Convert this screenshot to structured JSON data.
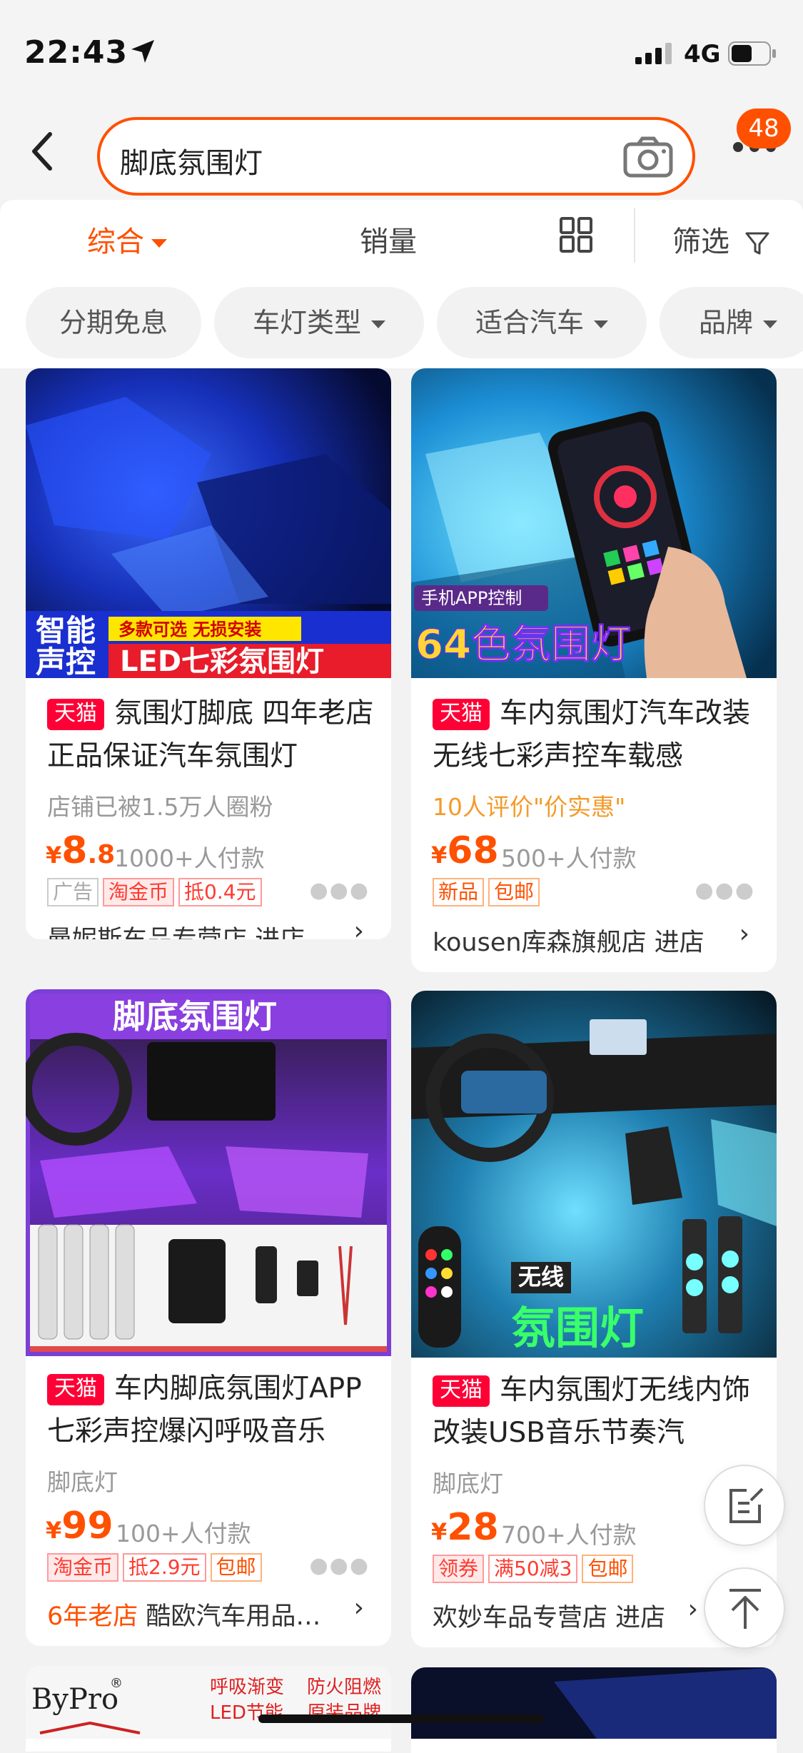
{
  "status_bar": {
    "time": "22:43",
    "network": "4G"
  },
  "header": {
    "search_query": "脚底氛围灯",
    "cart_badge": "48"
  },
  "sort_tabs": {
    "comprehensive": "综合",
    "sales": "销量",
    "filter": "筛选"
  },
  "filter_chips": [
    "分期免息",
    "车灯类型",
    "适合汽车",
    "品牌"
  ],
  "products": [
    {
      "image_text_1": "智能",
      "image_text_2": "声控",
      "image_banner": "多款可选 无损安装",
      "image_headline": "LED七彩氛围灯",
      "tmall": "天猫",
      "title": "氛围灯脚底 四年老店 正品保证汽车氛围灯",
      "subtitle": "店铺已被1.5万人圈粉",
      "price_symbol": "¥",
      "price_int": "8",
      "price_dec": ".8",
      "sold": "1000+人付款",
      "tags": [
        "广告",
        "淘金币",
        "抵0.4元"
      ],
      "store": "曼妮斯车品专营店",
      "enter": "进店"
    },
    {
      "image_badge": "手机APP控制",
      "image_headline": "64色氛围灯",
      "tmall": "天猫",
      "title": "车内氛围灯汽车改装无线七彩声控车载感",
      "subtitle": "10人评价\"价实惠\"",
      "price_symbol": "¥",
      "price_int": "68",
      "price_dec": "",
      "sold": "500+人付款",
      "tags": [
        "新品",
        "包邮"
      ],
      "store": "kousen库森旗舰店",
      "enter": "进店"
    },
    {
      "image_headline": "脚底氛围灯",
      "tmall": "天猫",
      "title": "车内脚底氛围灯APP七彩声控爆闪呼吸音乐",
      "subtitle": "脚底灯",
      "price_symbol": "¥",
      "price_int": "99",
      "price_dec": "",
      "sold": "100+人付款",
      "tags": [
        "淘金币",
        "抵2.9元",
        "包邮"
      ],
      "store_prefix": "6年老店",
      "store": "酷欧汽车用品…"
    },
    {
      "image_badge": "无线",
      "image_headline": "氛围灯",
      "tmall": "天猫",
      "title": "车内氛围灯无线内饰改装USB音乐节奏汽",
      "subtitle": "脚底灯",
      "price_symbol": "¥",
      "price_int": "28",
      "price_dec": "",
      "sold": "700+人付款",
      "tags": [
        "领券",
        "满50减3",
        "包邮"
      ],
      "store": "欢妙车品专营店",
      "enter": "进店"
    }
  ],
  "partial_row": {
    "brand": "ByPro",
    "reg": "®",
    "line1a": "呼吸渐变",
    "line1b": "防火阻燃",
    "line2a": "LED节能",
    "line2b": "原装品牌"
  },
  "colors": {
    "accent": "#ff5000",
    "tmall": "#ff0036"
  }
}
